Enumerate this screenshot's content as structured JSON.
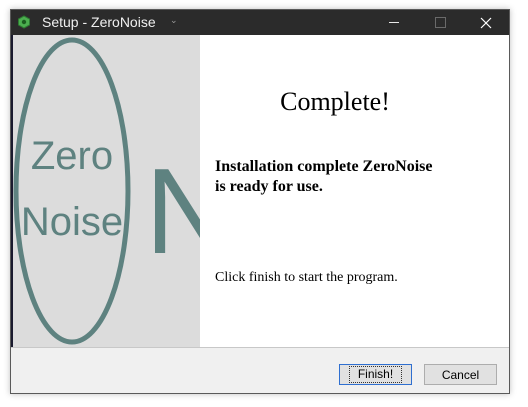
{
  "window": {
    "title": "Setup - ZeroNoise",
    "caret": "⌄",
    "controls": [
      "minimize",
      "maximize",
      "close"
    ]
  },
  "side_panel": {
    "logo_line1": "Zero",
    "logo_line2": "Noise",
    "logo_letter": "N",
    "logo_color": "#5e8280"
  },
  "content": {
    "heading": "Complete!",
    "message_line1": "Installation complete ZeroNoise",
    "message_line2": "is ready for use.",
    "instruction": "Click finish to start the program."
  },
  "buttons": {
    "finish": "Finish!",
    "cancel": "Cancel"
  },
  "colors": {
    "titlebar": "#2b2b2b",
    "accent": "#2f6fd0"
  },
  "icons": {
    "app": "zeronoise-app-icon",
    "close": "close-icon"
  }
}
